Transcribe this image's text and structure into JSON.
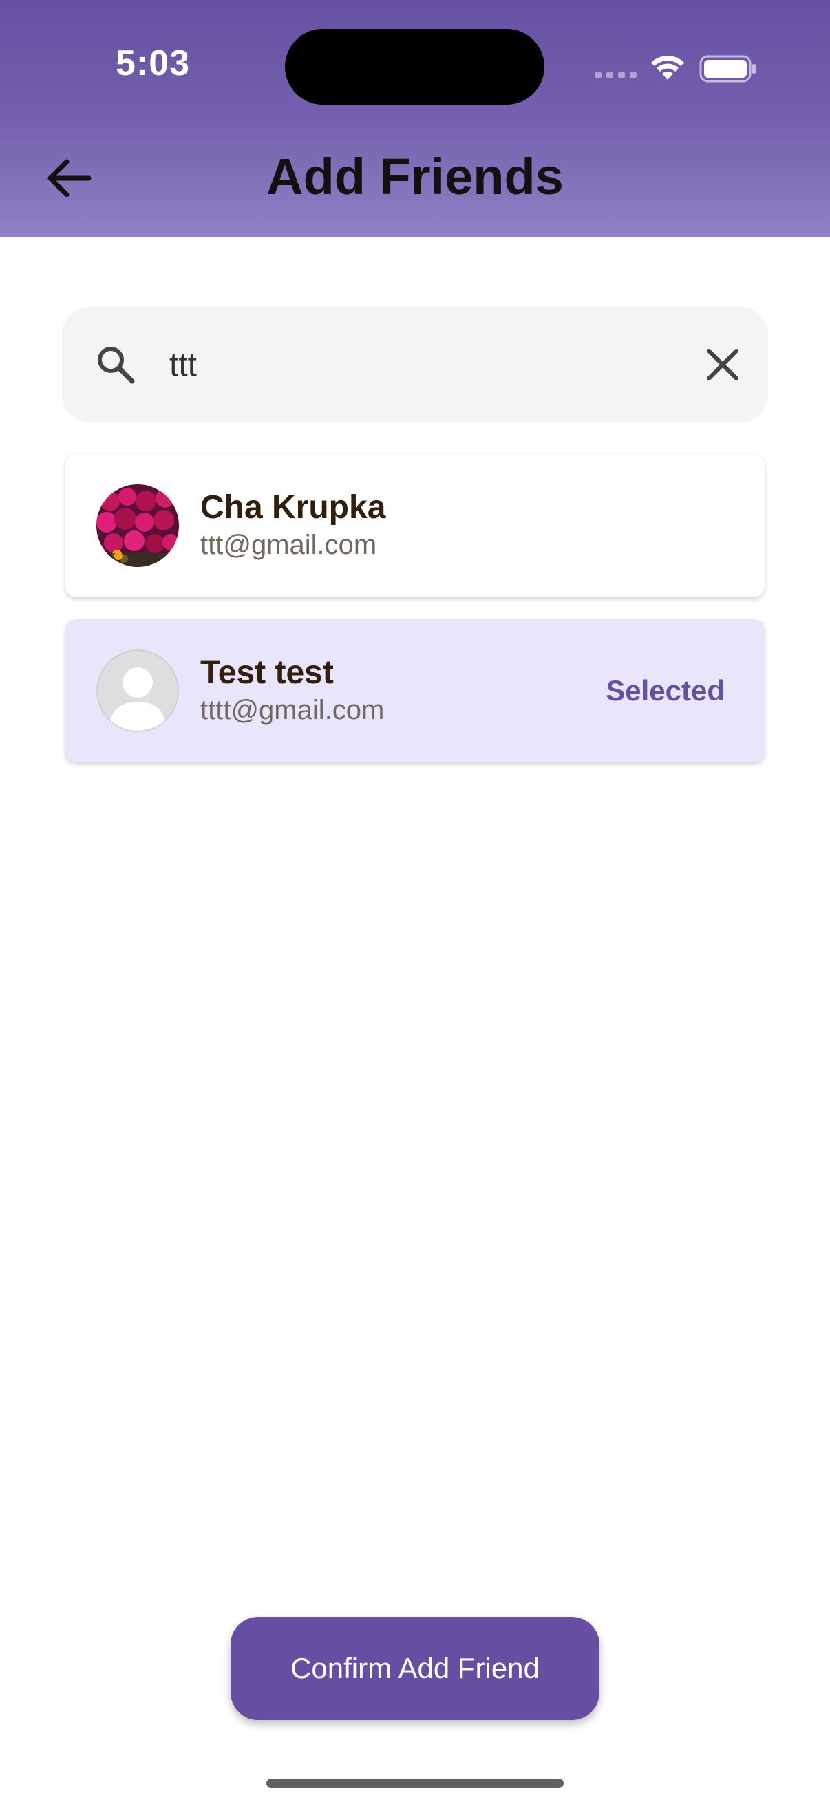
{
  "status_bar": {
    "time": "5:03"
  },
  "header": {
    "title": "Add Friends",
    "back_icon": "arrow-left-icon"
  },
  "search": {
    "value": "ttt",
    "placeholder": "",
    "search_icon": "search-icon",
    "clear_icon": "close-icon"
  },
  "results": [
    {
      "name": "Cha Krupka",
      "email": "ttt@gmail.com",
      "avatar": "photo-avatar",
      "selected": false
    },
    {
      "name": "Test test",
      "email": "tttt@gmail.com",
      "avatar": "default-user-avatar",
      "selected": true,
      "status_label": "Selected"
    }
  ],
  "confirm_button": {
    "label": "Confirm Add Friend"
  },
  "colors": {
    "header_gradient_top": "#6651a3",
    "header_gradient_bottom": "#9080c5",
    "accent": "#664ea2",
    "selected_row_bg": "#e9e6fc",
    "name_text": "#2f1f0c",
    "email_text": "#73685e"
  }
}
